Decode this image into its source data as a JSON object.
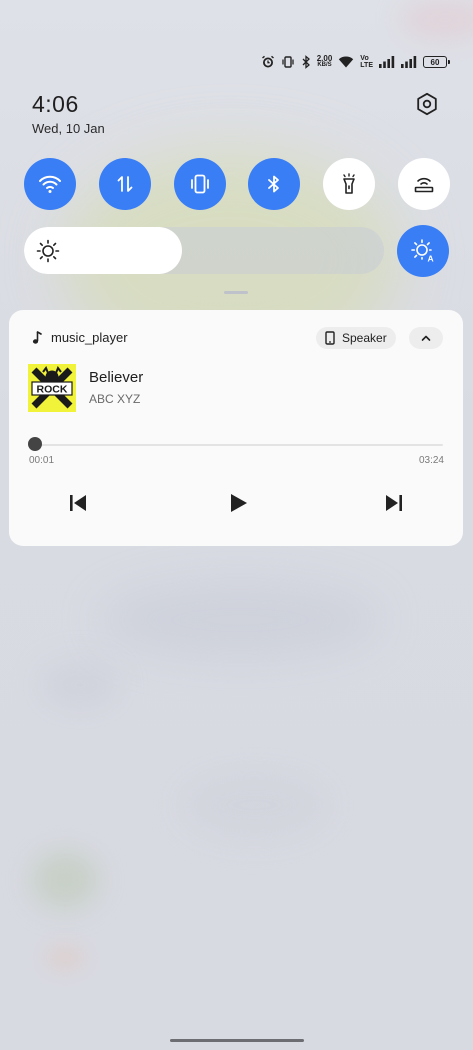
{
  "status_bar": {
    "net_speed_value": "2.00",
    "net_speed_unit": "KB/S",
    "volte_top": "Vo",
    "volte_bottom": "LTE",
    "battery_level": "60",
    "icons": [
      "alarm-icon",
      "vibrate-icon",
      "bluetooth-icon",
      "wifi-icon",
      "signal-icon",
      "signal-icon",
      "battery-icon"
    ]
  },
  "header": {
    "time": "4:06",
    "date": "Wed, 10 Jan",
    "settings_icon": "settings-icon"
  },
  "quick_toggles": [
    {
      "name": "wifi",
      "icon": "wifi-icon",
      "active": true
    },
    {
      "name": "mobile-data",
      "icon": "data-arrows-icon",
      "active": true
    },
    {
      "name": "vibrate",
      "icon": "vibrate-icon",
      "active": true
    },
    {
      "name": "bluetooth",
      "icon": "bluetooth-icon",
      "active": true
    },
    {
      "name": "flashlight",
      "icon": "flashlight-icon",
      "active": false
    },
    {
      "name": "hotspot",
      "icon": "hotspot-icon",
      "active": false
    }
  ],
  "brightness": {
    "level": 0.44,
    "auto_icon": "auto-brightness-icon"
  },
  "media": {
    "app_name": "music_player",
    "output_device": "Speaker",
    "track_title": "Believer",
    "artist": "ABC XYZ",
    "album_art_text": "ROCK",
    "elapsed": "00:01",
    "duration": "03:24",
    "progress": 0.005
  },
  "colors": {
    "accent": "#3a7ef6",
    "card_bg": "#fafafa",
    "album_yellow": "#f1f23a"
  }
}
